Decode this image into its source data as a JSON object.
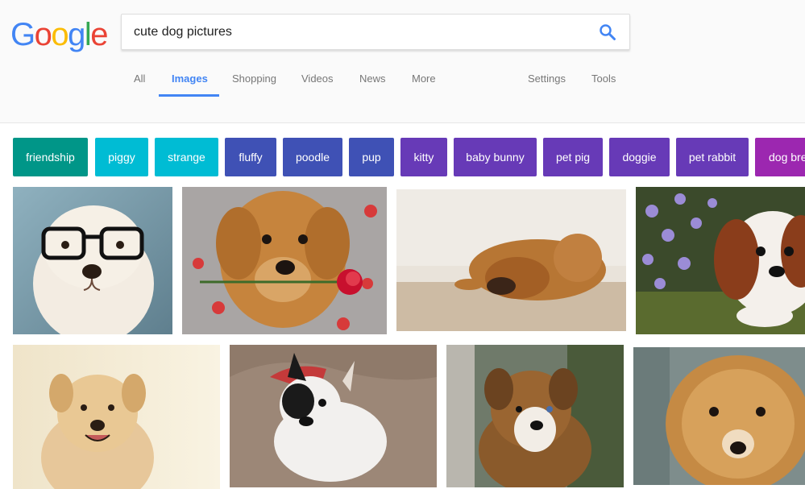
{
  "logo": {
    "letters": [
      "G",
      "o",
      "o",
      "g",
      "l",
      "e"
    ],
    "colors": [
      "#4285f4",
      "#ea4335",
      "#fbbc05",
      "#4285f4",
      "#34a853",
      "#ea4335"
    ]
  },
  "search": {
    "query": "cute dog pictures",
    "icon": "search-icon"
  },
  "tabs": [
    {
      "label": "All"
    },
    {
      "label": "Images",
      "active": true
    },
    {
      "label": "Shopping"
    },
    {
      "label": "Videos"
    },
    {
      "label": "News"
    },
    {
      "label": "More"
    }
  ],
  "tools": [
    {
      "label": "Settings"
    },
    {
      "label": "Tools"
    }
  ],
  "chips": [
    {
      "label": "friendship",
      "color": "#009688"
    },
    {
      "label": "piggy",
      "color": "#00bcd4"
    },
    {
      "label": "strange",
      "color": "#00bcd4"
    },
    {
      "label": "fluffy",
      "color": "#3f51b5"
    },
    {
      "label": "poodle",
      "color": "#3f51b5"
    },
    {
      "label": "pup",
      "color": "#3f51b5"
    },
    {
      "label": "kitty",
      "color": "#673ab7"
    },
    {
      "label": "baby bunny",
      "color": "#673ab7"
    },
    {
      "label": "pet pig",
      "color": "#673ab7"
    },
    {
      "label": "doggie",
      "color": "#673ab7"
    },
    {
      "label": "pet rabbit",
      "color": "#673ab7"
    },
    {
      "label": "dog bre",
      "color": "#9c27b0"
    }
  ],
  "colors": {
    "accent": "#4285f4"
  }
}
